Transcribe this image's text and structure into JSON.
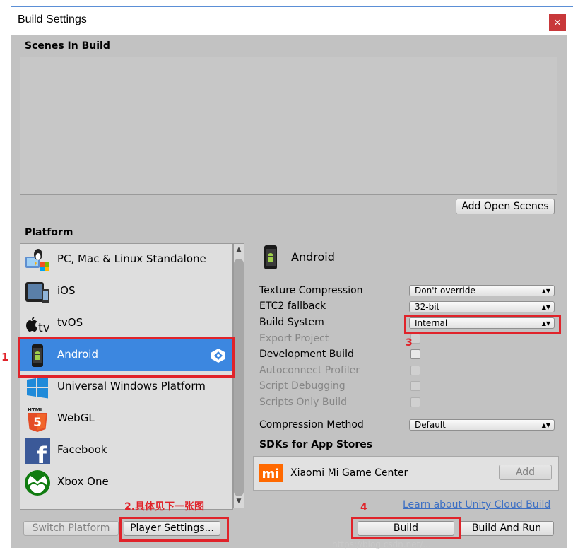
{
  "window": {
    "title": "Build Settings",
    "close_glyph": "×"
  },
  "scenes": {
    "label": "Scenes In Build",
    "add_open_scenes": "Add Open Scenes"
  },
  "platform": {
    "label": "Platform",
    "items": [
      {
        "name": "PC, Mac & Linux Standalone",
        "icon": "pc-mac-linux-icon",
        "selected": false
      },
      {
        "name": "iOS",
        "icon": "ios-device-icon",
        "selected": false
      },
      {
        "name": "tvOS",
        "icon": "apple-tv-icon",
        "icon_text": "tv",
        "selected": false
      },
      {
        "name": "Android",
        "icon": "android-icon",
        "selected": true
      },
      {
        "name": "Universal Windows Platform",
        "icon": "windows-icon",
        "selected": false
      },
      {
        "name": "WebGL",
        "icon": "html5-icon",
        "icon_text": "HTML",
        "icon_digit": "5",
        "selected": false
      },
      {
        "name": "Facebook",
        "icon": "facebook-icon",
        "icon_text": "f",
        "selected": false
      },
      {
        "name": "Xbox One",
        "icon": "xbox-icon",
        "selected": false
      }
    ]
  },
  "details": {
    "platform_name": "Android",
    "texture_compression": {
      "label": "Texture Compression",
      "value": "Don't override"
    },
    "etc2_fallback": {
      "label": "ETC2 fallback",
      "value": "32-bit"
    },
    "build_system": {
      "label": "Build System",
      "value": "Internal"
    },
    "export_project": {
      "label": "Export Project"
    },
    "development_build": {
      "label": "Development Build"
    },
    "autoconnect_profiler": {
      "label": "Autoconnect Profiler"
    },
    "script_debugging": {
      "label": "Script Debugging"
    },
    "scripts_only_build": {
      "label": "Scripts Only Build"
    },
    "compression_method": {
      "label": "Compression Method",
      "value": "Default"
    }
  },
  "sdks": {
    "label": "SDKs for App Stores",
    "items": [
      {
        "name": "Xiaomi Mi Game Center",
        "logo": "mi-logo-icon",
        "logo_text": "mi",
        "button": "Add"
      }
    ]
  },
  "cloud_build_link": "Learn about Unity Cloud Build",
  "buttons": {
    "switch_platform": "Switch Platform",
    "player_settings": "Player Settings...",
    "build": "Build",
    "build_and_run": "Build And Run"
  },
  "annotations": {
    "a1": "1",
    "a2": "2.具体见下一张图",
    "a3": "3",
    "a4": "4"
  },
  "watermark": "https://blog.csdn.net/...",
  "colors": {
    "selection": "#3c87e0",
    "annotation_red": "#e0232a",
    "panel": "#c2c2c2",
    "close": "#c8383a"
  }
}
